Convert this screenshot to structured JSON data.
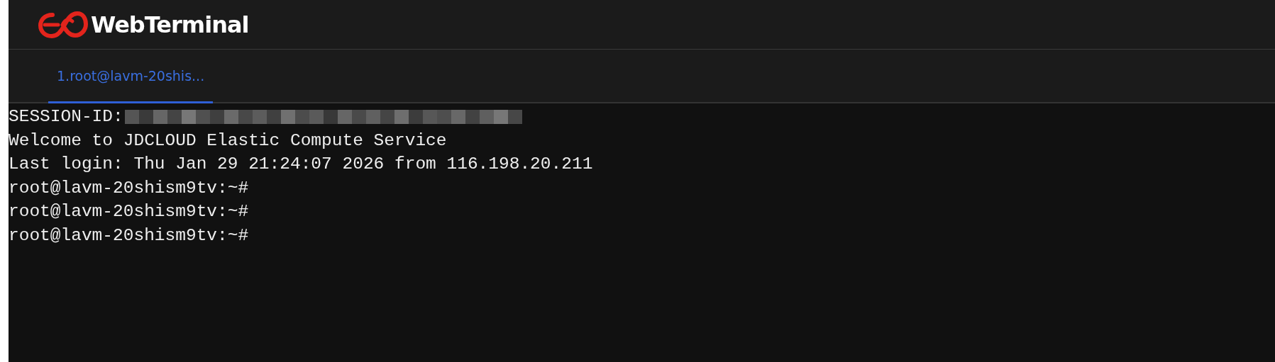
{
  "header": {
    "title": "WebTerminal"
  },
  "tabs": [
    {
      "label": "1.root@lavm-20shis...",
      "selected": true
    }
  ],
  "terminal": {
    "lines": [
      {
        "kind": "redacted",
        "text": "SESSION-ID:"
      },
      {
        "kind": "text",
        "text": "Welcome to JDCLOUD Elastic Compute Service"
      },
      {
        "kind": "text",
        "text": "Last login: Thu Jan 29 21:24:07 2026 from 116.198.20.211"
      },
      {
        "kind": "text",
        "text": "root@lavm-20shism9tv:~#"
      },
      {
        "kind": "text",
        "text": "root@lavm-20shism9tv:~#"
      },
      {
        "kind": "text",
        "text": "root@lavm-20shism9tv:~#"
      }
    ]
  }
}
